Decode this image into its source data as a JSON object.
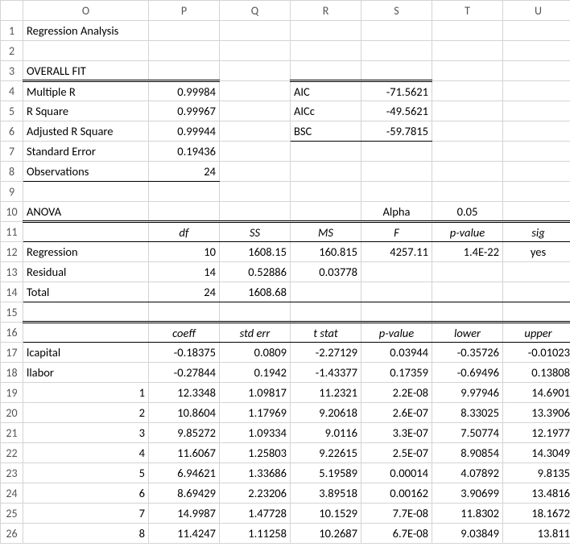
{
  "title": "Regression Analysis",
  "overall_fit_label": "OVERALL FIT",
  "fit": {
    "multiple_r": {
      "label": "Multiple R",
      "value": "0.99984"
    },
    "r_square": {
      "label": "R Square",
      "value": "0.99967"
    },
    "adj_r_square": {
      "label": "Adjusted R Square",
      "value": "0.99944"
    },
    "std_error": {
      "label": "Standard Error",
      "value": "0.19436"
    },
    "observations": {
      "label": "Observations",
      "value": "24"
    }
  },
  "infocrit": {
    "aic": {
      "label": "AIC",
      "value": "-71.5621"
    },
    "aicc": {
      "label": "AICc",
      "value": "-49.5621"
    },
    "bsc": {
      "label": "BSC",
      "value": "-59.7815"
    }
  },
  "anova": {
    "label": "ANOVA",
    "alpha_label": "Alpha",
    "alpha_value": "0.05",
    "headers": {
      "df": "df",
      "ss": "SS",
      "ms": "MS",
      "f": "F",
      "p": "p-value",
      "sig": "sig"
    },
    "regression": {
      "label": "Regression",
      "df": "10",
      "ss": "1608.15",
      "ms": "160.815",
      "f": "4257.11",
      "p": "1.4E-22",
      "sig": "yes"
    },
    "residual": {
      "label": "Residual",
      "df": "14",
      "ss": "0.52886",
      "ms": "0.03778"
    },
    "total": {
      "label": "Total",
      "df": "24",
      "ss": "1608.68"
    }
  },
  "coef_headers": {
    "coeff": "coeff",
    "stderr": "std err",
    "tstat": "t stat",
    "pvalue": "p-value",
    "lower": "lower",
    "upper": "upper"
  },
  "coef_rows": [
    {
      "name": "lcapital",
      "coeff": "-0.18375",
      "stderr": "0.0809",
      "tstat": "-2.27129",
      "pvalue": "0.03944",
      "lower": "-0.35726",
      "upper": "-0.01023"
    },
    {
      "name": "llabor",
      "coeff": "-0.27844",
      "stderr": "0.1942",
      "tstat": "-1.43377",
      "pvalue": "0.17359",
      "lower": "-0.69496",
      "upper": "0.13808"
    },
    {
      "name": "1",
      "coeff": "12.3348",
      "stderr": "1.09817",
      "tstat": "11.2321",
      "pvalue": "2.2E-08",
      "lower": "9.97946",
      "upper": "14.6901"
    },
    {
      "name": "2",
      "coeff": "10.8604",
      "stderr": "1.17969",
      "tstat": "9.20618",
      "pvalue": "2.6E-07",
      "lower": "8.33025",
      "upper": "13.3906"
    },
    {
      "name": "3",
      "coeff": "9.85272",
      "stderr": "1.09334",
      "tstat": "9.0116",
      "pvalue": "3.3E-07",
      "lower": "7.50774",
      "upper": "12.1977"
    },
    {
      "name": "4",
      "coeff": "11.6067",
      "stderr": "1.25803",
      "tstat": "9.22615",
      "pvalue": "2.5E-07",
      "lower": "8.90854",
      "upper": "14.3049"
    },
    {
      "name": "5",
      "coeff": "6.94621",
      "stderr": "1.33686",
      "tstat": "5.19589",
      "pvalue": "0.00014",
      "lower": "4.07892",
      "upper": "9.8135"
    },
    {
      "name": "6",
      "coeff": "8.69429",
      "stderr": "2.23206",
      "tstat": "3.89518",
      "pvalue": "0.00162",
      "lower": "3.90699",
      "upper": "13.4816"
    },
    {
      "name": "7",
      "coeff": "14.9987",
      "stderr": "1.47728",
      "tstat": "10.1529",
      "pvalue": "7.7E-08",
      "lower": "11.8302",
      "upper": "18.1672"
    },
    {
      "name": "8",
      "coeff": "11.4247",
      "stderr": "1.11258",
      "tstat": "10.2687",
      "pvalue": "6.7E-08",
      "lower": "9.03849",
      "upper": "13.811"
    }
  ],
  "columns": [
    "O",
    "P",
    "Q",
    "R",
    "S",
    "T",
    "U"
  ],
  "chart_data": {
    "type": "table",
    "title": "Regression Analysis",
    "sections": {
      "overall_fit": {
        "Multiple R": 0.99984,
        "R Square": 0.99967,
        "Adjusted R Square": 0.99944,
        "Standard Error": 0.19436,
        "Observations": 24
      },
      "info_criteria": {
        "AIC": -71.5621,
        "AICc": -49.5621,
        "BSC": -59.7815
      },
      "anova": {
        "alpha": 0.05,
        "rows": [
          {
            "name": "Regression",
            "df": 10,
            "SS": 1608.15,
            "MS": 160.815,
            "F": 4257.11,
            "p_value": 1.4e-22,
            "sig": "yes"
          },
          {
            "name": "Residual",
            "df": 14,
            "SS": 0.52886,
            "MS": 0.03778
          },
          {
            "name": "Total",
            "df": 24,
            "SS": 1608.68
          }
        ]
      },
      "coefficients": {
        "columns": [
          "coeff",
          "std err",
          "t stat",
          "p-value",
          "lower",
          "upper"
        ],
        "rows": [
          {
            "name": "lcapital",
            "coeff": -0.18375,
            "std_err": 0.0809,
            "t_stat": -2.27129,
            "p_value": 0.03944,
            "lower": -0.35726,
            "upper": -0.01023
          },
          {
            "name": "llabor",
            "coeff": -0.27844,
            "std_err": 0.1942,
            "t_stat": -1.43377,
            "p_value": 0.17359,
            "lower": -0.69496,
            "upper": 0.13808
          },
          {
            "name": "1",
            "coeff": 12.3348,
            "std_err": 1.09817,
            "t_stat": 11.2321,
            "p_value": 2.2e-08,
            "lower": 9.97946,
            "upper": 14.6901
          },
          {
            "name": "2",
            "coeff": 10.8604,
            "std_err": 1.17969,
            "t_stat": 9.20618,
            "p_value": 2.6e-07,
            "lower": 8.33025,
            "upper": 13.3906
          },
          {
            "name": "3",
            "coeff": 9.85272,
            "std_err": 1.09334,
            "t_stat": 9.0116,
            "p_value": 3.3e-07,
            "lower": 7.50774,
            "upper": 12.1977
          },
          {
            "name": "4",
            "coeff": 11.6067,
            "std_err": 1.25803,
            "t_stat": 9.22615,
            "p_value": 2.5e-07,
            "lower": 8.90854,
            "upper": 14.3049
          },
          {
            "name": "5",
            "coeff": 6.94621,
            "std_err": 1.33686,
            "t_stat": 5.19589,
            "p_value": 0.00014,
            "lower": 4.07892,
            "upper": 9.8135
          },
          {
            "name": "6",
            "coeff": 8.69429,
            "std_err": 2.23206,
            "t_stat": 3.89518,
            "p_value": 0.00162,
            "lower": 3.90699,
            "upper": 13.4816
          },
          {
            "name": "7",
            "coeff": 14.9987,
            "std_err": 1.47728,
            "t_stat": 10.1529,
            "p_value": 7.7e-08,
            "lower": 11.8302,
            "upper": 18.1672
          },
          {
            "name": "8",
            "coeff": 11.4247,
            "std_err": 1.11258,
            "t_stat": 10.2687,
            "p_value": 6.7e-08,
            "lower": 9.03849,
            "upper": 13.811
          }
        ]
      }
    }
  }
}
